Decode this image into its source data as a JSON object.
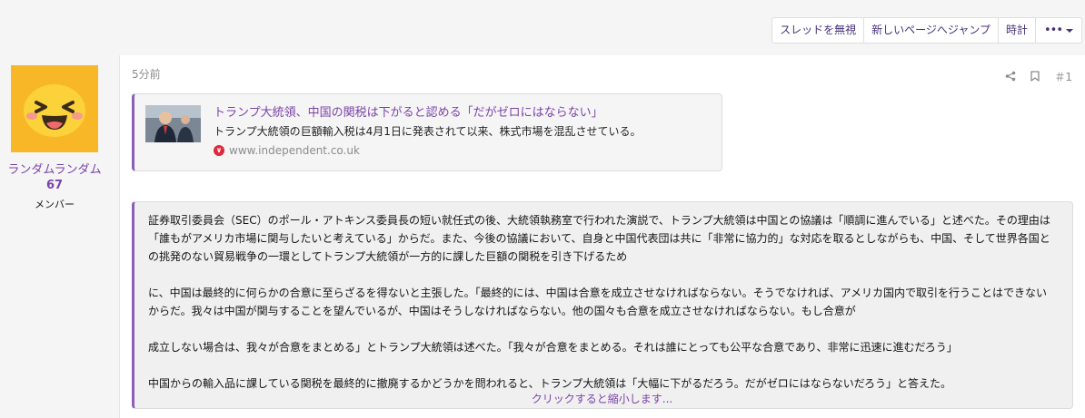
{
  "toolbar": {
    "ignore_thread": "スレッドを無視",
    "jump_to_new": "新しいページへジャンプ",
    "watch": "時計",
    "more_icon": "ellipsis-icon"
  },
  "user": {
    "name": "ランダムランダム",
    "count": "67",
    "role": "メンバー"
  },
  "post": {
    "time": "5分前",
    "number": "＃1",
    "embed": {
      "title": "トランプ大統領、中国の関税は下がると認める「だがゼロにはならない」",
      "description": "トランプ大統領の巨額輸入税は4月1日に発表されて以来、株式市場を混乱させている。",
      "site": "www.independent.co.uk"
    },
    "quote": {
      "p1": "証券取引委員会（SEC）のポール・アトキンス委員長の短い就任式の後、大統領執務室で行われた演説で、トランプ大統領は中国との協議は「順調に進んでいる」と述べた。その理由は「誰もがアメリカ市場に関与したいと考えている」からだ。また、今後の協議において、自身と中国代表団は共に「非常に協力的」な対応を取るとしながらも、中国、そして世界各国との挑発のない貿易戦争の一環としてトランプ大統領が一方的に課した巨額の関税を引き下げるため",
      "p2": "に、中国は最終的に何らかの合意に至らざるを得ないと主張した。「最終的には、中国は合意を成立させなければならない。そうでなければ、アメリカ国内で取引を行うことはできないからだ。我々は中国が関与することを望んでいるが、中国はそうしなければならない。他の国々も合意を成立させなければならない。もし合意が",
      "p3": "成立しない場合は、我々が合意をまとめる」とトランプ大統領は述べた。「我々が合意をまとめる。それは誰にとっても公平な合意であり、非常に迅速に進むだろう」",
      "p4": "中国からの輸入品に課している関税を最終的に撤廃するかどうかを問われると、トランプ大統領は「大幅に下がるだろう。だがゼロにはならないだろう」と答えた。",
      "expand": "クリックすると縮小します..."
    }
  },
  "colors": {
    "accent": "#7a44a8",
    "quote_border": "#8a5fb6",
    "avatar_bg": "#f8b726"
  }
}
